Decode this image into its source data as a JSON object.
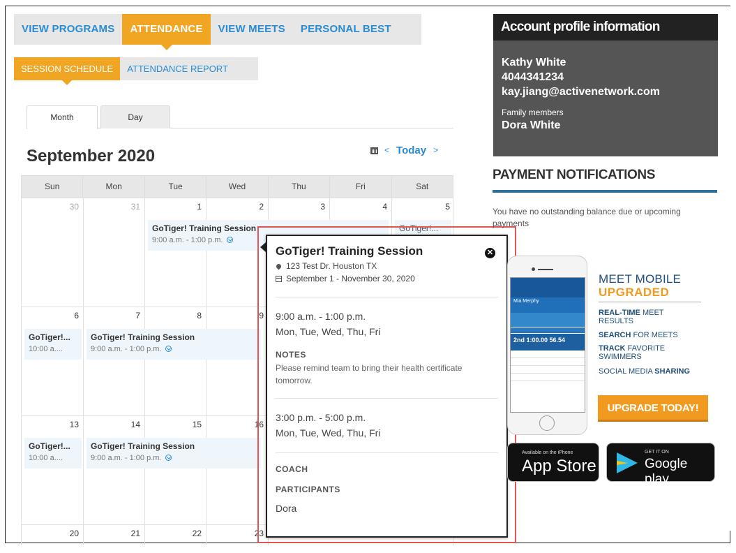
{
  "main_nav": {
    "items": [
      {
        "label": "VIEW PROGRAMS"
      },
      {
        "label": "ATTENDANCE"
      },
      {
        "label": "VIEW MEETS"
      },
      {
        "label": "PERSONAL BEST"
      }
    ],
    "active": "ATTENDANCE"
  },
  "sub_nav": {
    "items": [
      {
        "label": "SESSION SCHEDULE"
      },
      {
        "label": "ATTENDANCE REPORT"
      }
    ],
    "active": "SESSION SCHEDULE"
  },
  "view_tabs": {
    "month": "Month",
    "day": "Day",
    "active": "Month"
  },
  "calendar": {
    "title": "September 2020",
    "prev": "<",
    "today": "Today",
    "next": ">",
    "weekdays": [
      "Sun",
      "Mon",
      "Tue",
      "Wed",
      "Thu",
      "Fri",
      "Sat"
    ],
    "weeks": [
      [
        "30",
        "31",
        "1",
        "2",
        "3",
        "4",
        "5"
      ],
      [
        "6",
        "7",
        "8",
        "9",
        "",
        "",
        ""
      ],
      [
        "13",
        "14",
        "15",
        "16",
        "",
        "",
        ""
      ],
      [
        "20",
        "21",
        "22",
        "23",
        "",
        "",
        ""
      ]
    ],
    "events": {
      "wk1_tue": {
        "title": "GoTiger! Training Session",
        "time": "9:00 a.m. - 1:00 p.m."
      },
      "wk1_sat": {
        "title": "GoTiger!..."
      },
      "wk2_sun": {
        "title": "GoTiger!...",
        "time": "10:00 a...."
      },
      "wk2_mon": {
        "title": "GoTiger! Training Session",
        "time": "9:00 a.m. - 1:00 p.m."
      },
      "wk3_sun": {
        "title": "GoTiger!...",
        "time": "10:00 a...."
      },
      "wk3_mon": {
        "title": "GoTiger! Training Session",
        "time": "9:00 a.m. - 1:00 p.m."
      }
    }
  },
  "popup": {
    "title": "GoTiger! Training Session",
    "address": "123 Test Dr. Houston TX",
    "dates": "September 1 - November 30, 2020",
    "schedule1_time": "9:00 a.m. - 1:00 p.m.",
    "schedule1_days": "Mon, Tue, Wed, Thu, Fri",
    "notes_label": "NOTES",
    "notes_text": "Please remind team to bring their health certificate tomorrow.",
    "schedule2_time": "3:00 p.m. - 5:00 p.m.",
    "schedule2_days": "Mon, Tue, Wed, Thu, Fri",
    "coach_label": "COACH",
    "participants_label": "PARTICIPANTS",
    "participant": "Dora",
    "close_glyph": "✕"
  },
  "account": {
    "heading": "Account profile information",
    "name": "Kathy White",
    "phone": "4044341234",
    "email": "kay.jiang@activenetwork.com",
    "family_label": "Family members",
    "family_member": "Dora White"
  },
  "payment": {
    "heading": "PAYMENT NOTIFICATIONS",
    "message": "You have no outstanding balance due or upcoming payments"
  },
  "promo": {
    "title": "MEET MOBILE",
    "upgraded": "UPGRADED",
    "f1_bold": "REAL-TIME",
    "f1_rest": " MEET RESULTS",
    "f2_bold": "SEARCH",
    "f2_rest": " FOR MEETS",
    "f3_bold": "TRACK",
    "f3_rest": " FAVORITE SWIMMERS",
    "f4_rest": "SOCIAL MEDIA ",
    "f4_bold": "SHARING",
    "upgrade_button": "UPGRADE TODAY!",
    "phone_name": "Mia Merphy",
    "phone_result": "2nd 1:00.00 56.54"
  },
  "stores": {
    "apple_small": "Available on the iPhone",
    "apple_big": "App Store",
    "google_small": "GET IT ON",
    "google_big": "Google play"
  },
  "colors": {
    "accent_orange": "#f0a523",
    "link_blue": "#2a8bd1",
    "dark_panel": "#555555",
    "popup_outline": "#e05555",
    "payment_bar": "#2b6f9a"
  }
}
